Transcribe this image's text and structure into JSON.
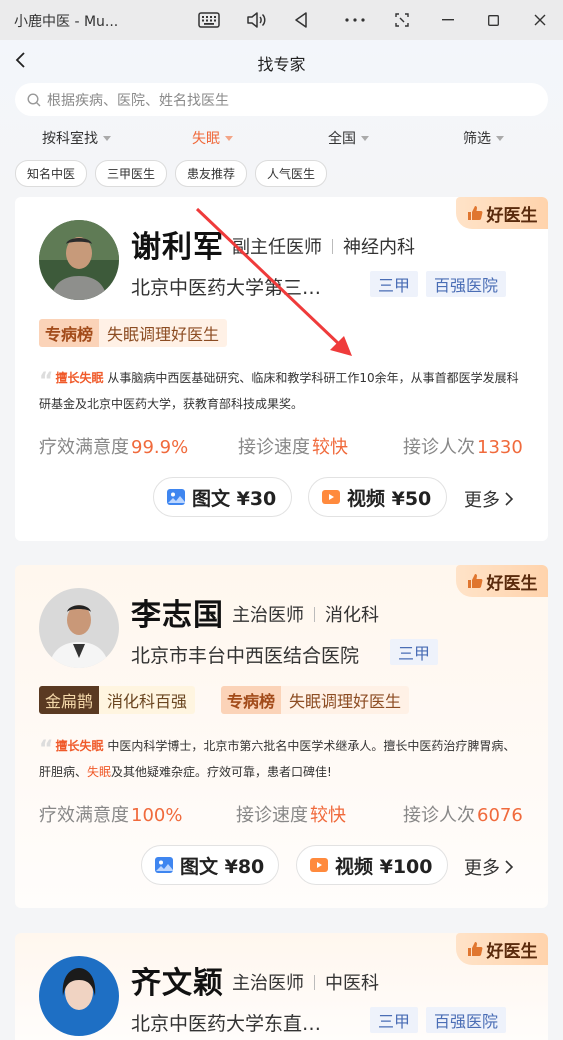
{
  "window": {
    "title": "小鹿中医 - Mu..."
  },
  "header": {
    "title": "找专家",
    "search_placeholder": "根据疾病、医院、姓名找医生",
    "filters": [
      {
        "label": "按科室找",
        "active": false
      },
      {
        "label": "失眠",
        "active": true
      },
      {
        "label": "全国",
        "active": false
      },
      {
        "label": "筛选",
        "active": false
      }
    ],
    "chips": [
      "知名中医",
      "三甲医生",
      "患友推荐",
      "人气医生"
    ]
  },
  "badge_label": "好医生",
  "accent": "#f06a3c",
  "doctors": [
    {
      "name": "谢利军",
      "title": "副主任医师",
      "dept": "神经内科",
      "hospital": "北京中医药大学第三…",
      "tags": [
        "三甲",
        "百强医院"
      ],
      "ranks": [
        {
          "k": "专病榜",
          "v": "失眠调理好医生"
        }
      ],
      "specialty_label": "擅长失眠",
      "desc": "从事脑病中西医基础研究、临床和教学科研工作10余年，从事首都医学发展科研基金及北京中医药大学，获教育部科技成果奖。",
      "stats": {
        "satisfaction_label": "疗效满意度",
        "satisfaction": "99.9%",
        "speed_label": "接诊速度",
        "speed": "较快",
        "count_label": "接诊人次",
        "count": "1330"
      },
      "services": [
        {
          "label": "图文 ¥30",
          "icon": "image-icon"
        },
        {
          "label": "视频 ¥50",
          "icon": "video-icon"
        }
      ],
      "more": "更多"
    },
    {
      "name": "李志国",
      "title": "主治医师",
      "dept": "消化科",
      "hospital": "北京市丰台中西医结合医院",
      "tags": [
        "三甲"
      ],
      "ranks": [
        {
          "k": "金扁鹊",
          "v": "消化科百强"
        },
        {
          "k": "专病榜",
          "v": "失眠调理好医生"
        }
      ],
      "specialty_label": "擅长失眠",
      "desc_a": "中医内科学博士，北京市第六批名中医学术继承人。擅长中医药治疗脾胃病、肝胆病、",
      "desc_hl": "失眠",
      "desc_b": "及其他疑难杂症。疗效可靠，患者口碑佳!",
      "stats": {
        "satisfaction_label": "疗效满意度",
        "satisfaction": "100%",
        "speed_label": "接诊速度",
        "speed": "较快",
        "count_label": "接诊人次",
        "count": "6076"
      },
      "services": [
        {
          "label": "图文 ¥80",
          "icon": "image-icon"
        },
        {
          "label": "视频 ¥100",
          "icon": "video-icon"
        }
      ],
      "more": "更多"
    },
    {
      "name": "齐文颖",
      "title": "主治医师",
      "dept": "中医科",
      "hospital": "北京中医药大学东直…",
      "tags": [
        "三甲",
        "百强医院"
      ]
    }
  ]
}
